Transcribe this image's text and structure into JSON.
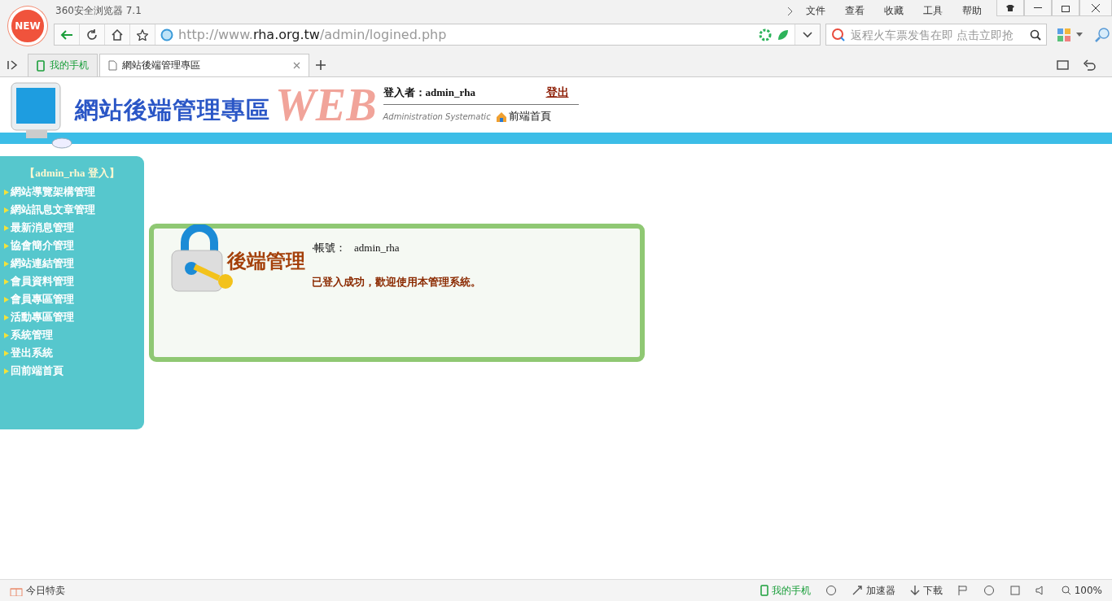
{
  "browser": {
    "title": "360安全浏览器 7.1",
    "badge": "NEW",
    "menu": [
      "文件",
      "查看",
      "收藏",
      "工具",
      "帮助"
    ],
    "url": {
      "prefix": "http://www.",
      "host": "rha.org.tw",
      "path": "/admin/logined.php"
    },
    "search": {
      "placeholder": "返程火车票发售在即 点击立即抢"
    },
    "tabs": [
      {
        "label": "我的手机",
        "kind": "phone",
        "selected": false
      },
      {
        "label": "網站後端管理專區",
        "kind": "page",
        "selected": true
      }
    ]
  },
  "header": {
    "title": "網站後端管理專區",
    "logo_word": "WEB",
    "user_label": "登入者：",
    "user": "admin_rha",
    "logout": "登出",
    "subtitle": "Administration Systematic",
    "home_link": "前端首頁"
  },
  "sidebar": {
    "heading": "【admin_rha 登入】",
    "items": [
      "網站導覽架構管理",
      "網站訊息文章管理",
      "最新消息管理",
      "協會簡介管理",
      "網站連結管理",
      "會員資料管理",
      "會員專區管理",
      "活動專區管理",
      "系統管理",
      "登出系統",
      "回前端首頁"
    ]
  },
  "panel": {
    "title": "後端管理",
    "account_label": "‧帳號：",
    "account": "admin_rha",
    "message": "已登入成功，歡迎使用本管理系統。"
  },
  "status_bar": {
    "left": "今日特卖",
    "phone": "我的手机",
    "accelerator": "加速器",
    "download": "下載",
    "zoom": "100%"
  }
}
